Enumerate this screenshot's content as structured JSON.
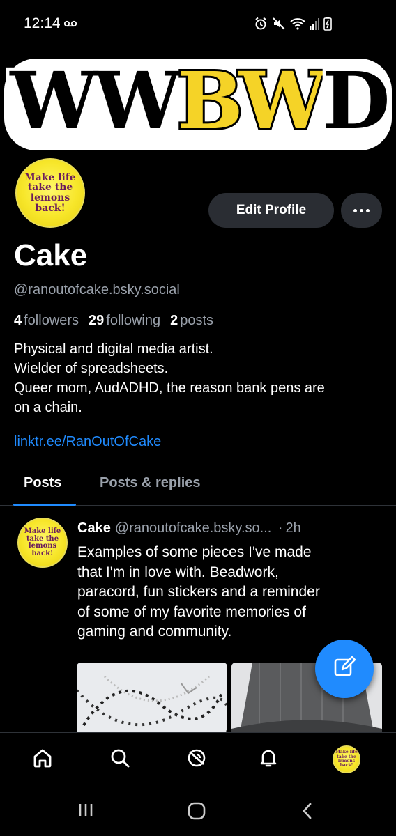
{
  "status_bar": {
    "time": "12:14"
  },
  "banner": {
    "text_white": "WW",
    "text_yellow": "BW",
    "text_white_end": "D",
    "yellow_color": "#f5d327"
  },
  "avatar": {
    "text": "Make life take the lemons back!"
  },
  "actions": {
    "edit_profile_label": "Edit Profile",
    "more_icon": "ellipsis-icon"
  },
  "profile": {
    "display_name": "Cake",
    "handle": "@ranoutofcake.bsky.social",
    "followers_count": "4",
    "followers_label": "followers",
    "following_count": "29",
    "following_label": "following",
    "posts_count": "2",
    "posts_label": "posts",
    "bio_lines": [
      "Physical and digital media artist.",
      "Wielder of spreadsheets.",
      "Queer mom, AudADHD, the reason bank pens are",
      "on a chain."
    ],
    "link": "linktr.ee/RanOutOfCake"
  },
  "tabs": [
    {
      "label": "Posts",
      "active": true
    },
    {
      "label": "Posts & replies",
      "active": false
    }
  ],
  "post": {
    "author": "Cake",
    "handle": "@ranoutofcake.bsky.so...",
    "separator": "·",
    "time": "2h",
    "text_lines": [
      "Examples of some pieces I've made",
      "that I'm in love with. Beadwork,",
      "paracord, fun stickers and a reminder",
      "of some of my favorite memories of",
      "gaming and community."
    ]
  },
  "bottom_nav": [
    {
      "icon": "home-icon"
    },
    {
      "icon": "search-icon"
    },
    {
      "icon": "feeds-icon"
    },
    {
      "icon": "bell-icon"
    },
    {
      "icon": "profile-avatar"
    }
  ],
  "colors": {
    "accent": "#208bfe",
    "background": "#000000",
    "secondary_text": "#9aa1ab",
    "button_bg": "#2a2d33"
  }
}
